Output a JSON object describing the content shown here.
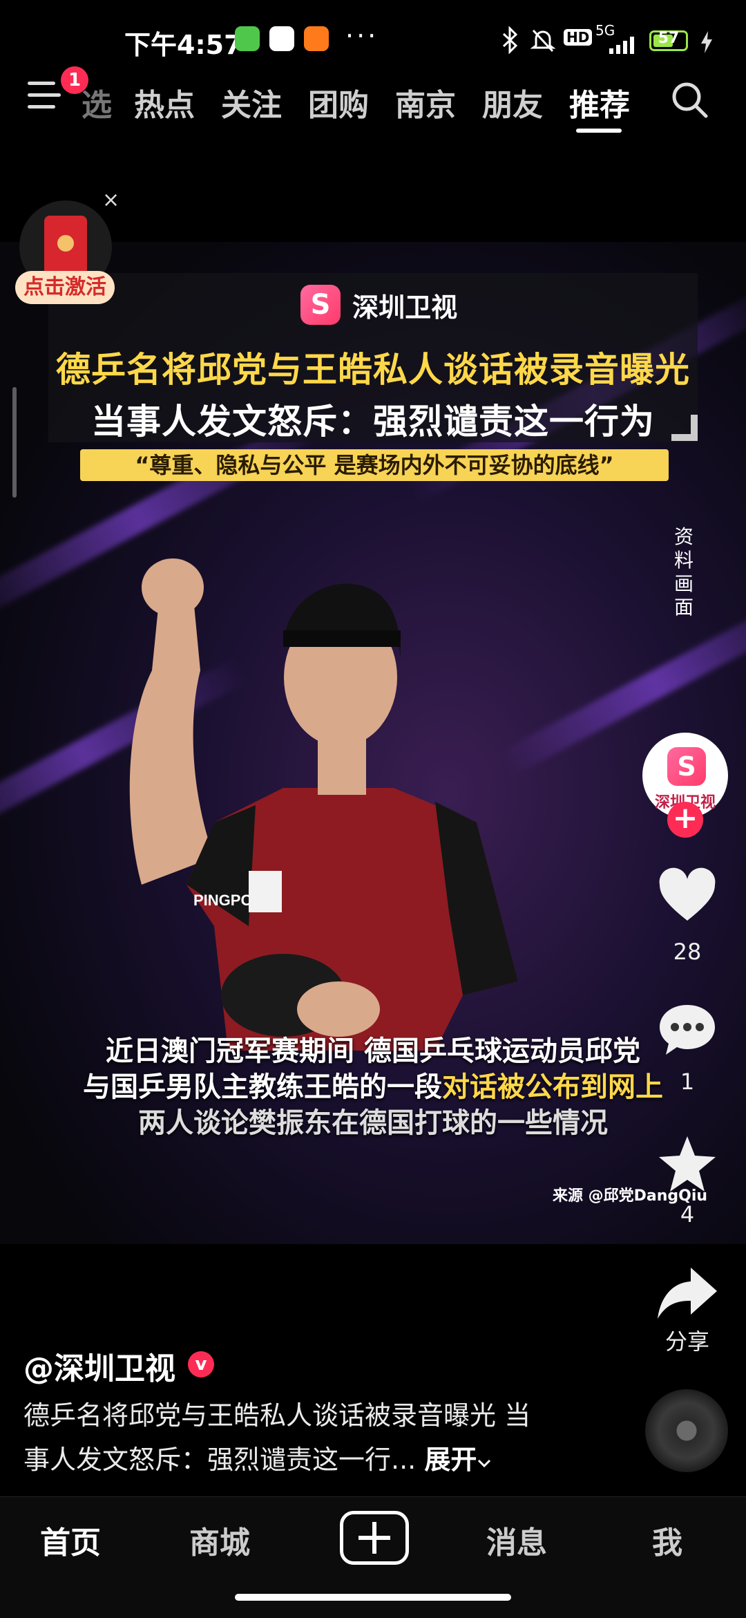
{
  "status_bar": {
    "time": "下午4:57",
    "app_icons": [
      "green-app-icon",
      "baidu-netdisk-icon",
      "58-app-icon"
    ],
    "more": "···",
    "network": "5G",
    "hd": "HD",
    "battery": "57",
    "icons": [
      "bluetooth-icon",
      "mute-bell-icon",
      "signal-icon",
      "charging-icon"
    ]
  },
  "top_nav": {
    "badge": "1",
    "tabs": [
      "热点",
      "关注",
      "团购",
      "南京",
      "朋友",
      "推荐"
    ],
    "active_tab": "推荐",
    "clipped_tab": "选"
  },
  "video": {
    "brand_name": "深圳卫视",
    "headline_line1": "德乒名将邱党与王皓私人谈话被录音曝光",
    "headline_line2": "当事人发文怒斥：强烈谴责这一行为",
    "quote": "“尊重、隐私与公平 是赛场内外不可妥协的底线”",
    "side_note": "资料画面",
    "caption_line1": "近日澳门冠军赛期间 德国乒乓球运动员邱党",
    "caption_line2_plain": "与国乒男队主教练王皓的一段",
    "caption_line2_highlight": "对话被公布到网上",
    "caption_line3": "两人谈论樊振东在德国打球的一些情况",
    "source": "来源 @邱党DangQiu",
    "jersey_text": "PINGPOD"
  },
  "red_packet": {
    "label": "点击激活",
    "close": "×"
  },
  "actions": {
    "avatar_name": "深圳卫视",
    "follow": "+",
    "likes": "28",
    "comments": "1",
    "favorites": "4",
    "share_label": "分享"
  },
  "post": {
    "author": "@深圳卫视",
    "verified": "v",
    "desc_line1": "德乒名将邱党与王皓私人谈话被录音曝光 当",
    "desc_line2": "事人发文怒斥：强烈谴责这一行...",
    "expand": "展开"
  },
  "bottom_nav": {
    "home": "首页",
    "mall": "商城",
    "messages": "消息",
    "me": "我"
  },
  "colors": {
    "accent": "#fe2c55",
    "headline_yellow": "#ffd84a",
    "quote_bg": "#f7d356",
    "battery_green": "#9be54a"
  }
}
